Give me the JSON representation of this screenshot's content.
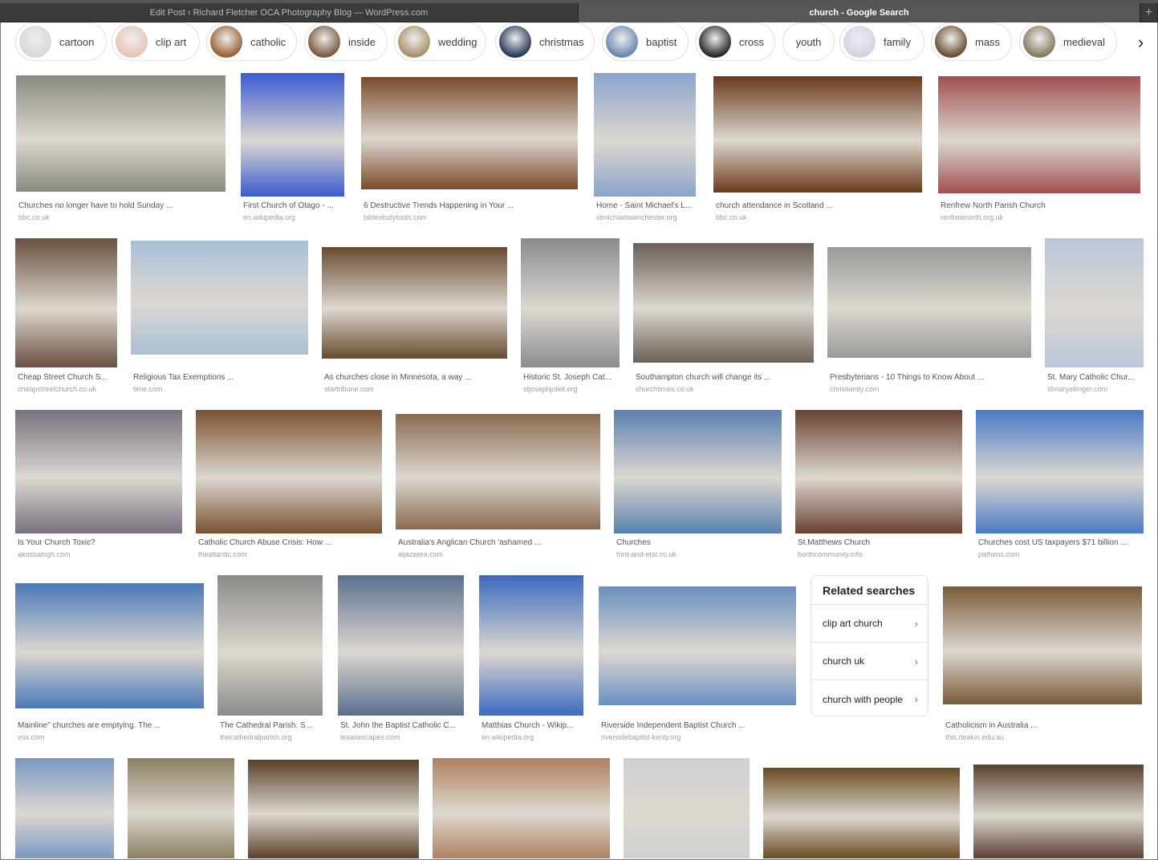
{
  "tabs": [
    {
      "label": "Edit Post ‹ Richard Fletcher OCA Photography Blog — WordPress.com"
    },
    {
      "label": "church - Google Search"
    }
  ],
  "new_tab": "+",
  "chips": [
    {
      "label": "cartoon",
      "color": "#d8d8d8"
    },
    {
      "label": "clip art",
      "color": "#e8c4b8"
    },
    {
      "label": "catholic",
      "color": "#9a6438"
    },
    {
      "label": "inside",
      "color": "#7a5a40"
    },
    {
      "label": "wedding",
      "color": "#a8926a"
    },
    {
      "label": "christmas",
      "color": "#2a3a5a"
    },
    {
      "label": "baptist",
      "color": "#6c88b0"
    },
    {
      "label": "cross",
      "color": "#2a2a2a"
    },
    {
      "label": "youth",
      "color": ""
    },
    {
      "label": "family",
      "color": "#d8d0e8"
    },
    {
      "label": "mass",
      "color": "#6a5030"
    },
    {
      "label": "medieval",
      "color": "#8a7a60"
    }
  ],
  "chip_next": "›",
  "results": [
    {
      "caption": "Churches no longer have to hold Sunday ...",
      "domain": "bbc.co.uk",
      "color": "#8a8a80"
    },
    {
      "caption": "First Church of Otago - ...",
      "domain": "en.wikipedia.org",
      "color": "#3a5ad0"
    },
    {
      "caption": "6 Destructive Trends Happening in Your ...",
      "domain": "biblestudytools.com",
      "color": "#7a4a2a"
    },
    {
      "caption": "Home - Saint Michael's L...",
      "domain": "stmichaelswinchester.org",
      "color": "#8aa4cc"
    },
    {
      "caption": "church attendance in Scotland ...",
      "domain": "bbc.co.uk",
      "color": "#6a3a1a"
    },
    {
      "caption": "Renfrew North Parish Church",
      "domain": "renfrewnorth.org.uk",
      "color": "#a05050"
    },
    {
      "caption": "Cheap Street Church S...",
      "domain": "cheapstreetchurch.co.uk",
      "color": "#6a5040"
    },
    {
      "caption": "Religious Tax Exemptions ...",
      "domain": "time.com",
      "color": "#a8c0d8"
    },
    {
      "caption": "As churches close in Minnesota, a way ...",
      "domain": "startribune.com",
      "color": "#6a4a30"
    },
    {
      "caption": "Historic St. Joseph Cat...",
      "domain": "stjosephjoliet.org",
      "color": "#8a8a90"
    },
    {
      "caption": "Southampton church will change its ...",
      "domain": "churchtimes.co.uk",
      "color": "#6a6058"
    },
    {
      "caption": "Presbyterians - 10 Things to Know About ...",
      "domain": "christianity.com",
      "color": "#9a9a98"
    },
    {
      "caption": "St. Mary Catholic Chur...",
      "domain": "stmaryellinger.com",
      "color": "#b8c8dc"
    },
    {
      "caption": "Is Your Church Toxic?",
      "domain": "akosbalogh.com",
      "color": "#7a7080"
    },
    {
      "caption": "Catholic Church Abuse Crisis: How ...",
      "domain": "theatlantic.com",
      "color": "#7a5030"
    },
    {
      "caption": "Australia's Anglican Church 'ashamed ...",
      "domain": "aljazeera.com",
      "color": "#8a6a50"
    },
    {
      "caption": "Churches",
      "domain": "ford-and-etal.co.uk",
      "color": "#5a80b0"
    },
    {
      "caption": "St.Matthews Church",
      "domain": "borthcommunity.info",
      "color": "#6a4030"
    },
    {
      "caption": "Churches cost US taxpayers $71 billion ...",
      "domain": "patheos.com",
      "color": "#4a7ac8"
    },
    {
      "caption": "Mainline\" churches are emptying. The ...",
      "domain": "vox.com",
      "color": "#4a78b8"
    },
    {
      "caption": "The Cathedral Parish: S...",
      "domain": "thecathedralparish.org",
      "color": "#8a8a88"
    },
    {
      "caption": "St. John the Baptist Catholic C...",
      "domain": "texasescapes.com",
      "color": "#5a7090"
    },
    {
      "caption": "Matthias Church - Wikip...",
      "domain": "en.wikipedia.org",
      "color": "#3a6ac0"
    },
    {
      "caption": "Riverside Independent Baptist Church ...",
      "domain": "riversidebaptist-kenly.org",
      "color": "#6a90c0"
    },
    {
      "caption": "Catholicism in Australia ...",
      "domain": "this.deakin.edu.au",
      "color": "#7a5a38"
    },
    {
      "caption": "",
      "domain": "",
      "color": "#7a98c0"
    },
    {
      "caption": "",
      "domain": "",
      "color": "#8a8060"
    },
    {
      "caption": "",
      "domain": "",
      "color": "#5a4028"
    },
    {
      "caption": "",
      "domain": "",
      "color": "#b08060"
    },
    {
      "caption": "",
      "domain": "",
      "color": "#d0d0d0"
    },
    {
      "caption": "",
      "domain": "",
      "color": "#6a4a20"
    },
    {
      "caption": "",
      "domain": "",
      "color": "#5a4030"
    }
  ],
  "related": {
    "title": "Related searches",
    "items": [
      "clip art church",
      "church uk",
      "church with people"
    ],
    "chevron": "›"
  }
}
